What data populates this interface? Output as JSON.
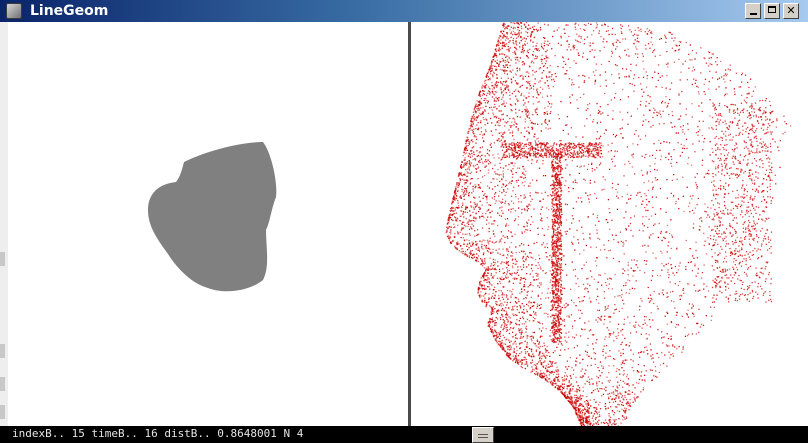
{
  "window": {
    "title": "LineGeom",
    "icon": "application-icon",
    "controls": [
      "minimize-icon",
      "maximize-icon",
      "close-icon"
    ],
    "close_glyph": "✕"
  },
  "left_view": {
    "shape": "gray-face-silhouette",
    "fill_color": "#808080",
    "background": "#ffffff"
  },
  "right_view": {
    "shape": "point-cloud-face-profile",
    "point_color": "#cc0000",
    "background": "#ffffff"
  },
  "status": {
    "text": "indexB.. 15 timeB.. 16 distB.. 0.8648001 N 4"
  },
  "colors": {
    "titlebar_start": "#0a246a",
    "titlebar_end": "#a6caf0",
    "divider": "#4a4a4a",
    "statusbar": "#000000"
  }
}
